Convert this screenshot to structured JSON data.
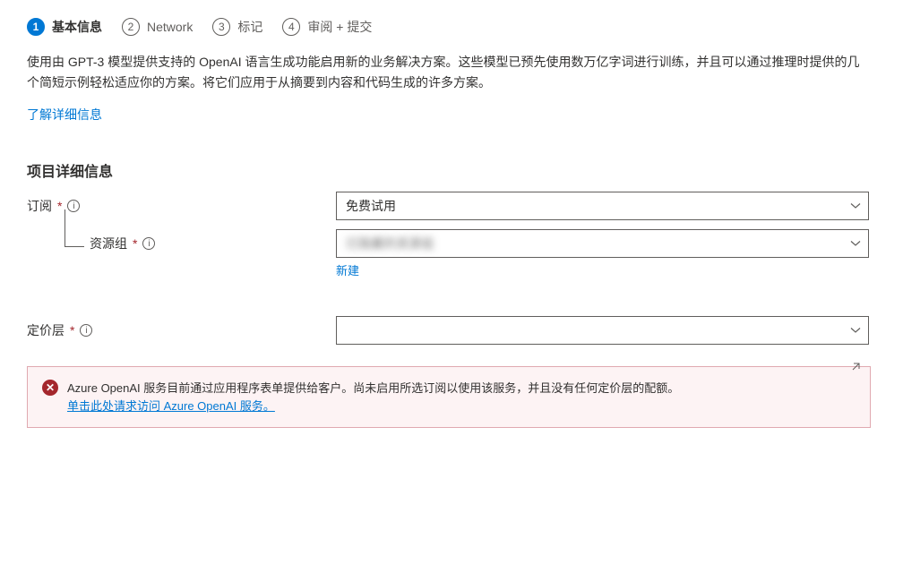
{
  "tabs": [
    {
      "num": "1",
      "label": "基本信息",
      "active": true
    },
    {
      "num": "2",
      "label": "Network",
      "active": false
    },
    {
      "num": "3",
      "label": "标记",
      "active": false
    },
    {
      "num": "4",
      "label": "审阅 + 提交",
      "active": false
    }
  ],
  "description": "使用由 GPT-3 模型提供支持的 OpenAI 语言生成功能启用新的业务解决方案。这些模型已预先使用数万亿字词进行训练，并且可以通过推理时提供的几个简短示例轻松适应你的方案。将它们应用于从摘要到内容和代码生成的许多方案。",
  "learn_more": "了解详细信息",
  "section_title": "项目详细信息",
  "fields": {
    "subscription": {
      "label": "订阅",
      "value": "免费试用"
    },
    "resource_group": {
      "label": "资源组",
      "value": "已隐藏的资源组",
      "create_new": "新建"
    },
    "pricing_tier": {
      "label": "定价层",
      "value": ""
    }
  },
  "error": {
    "text_before": "Azure OpenAI 服务目前通过应用程序表单提供给客户。尚未启用所选订阅以使用该服务，并且没有任何定价层的配额。",
    "link": "单击此处请求访问 Azure OpenAI 服务。"
  }
}
